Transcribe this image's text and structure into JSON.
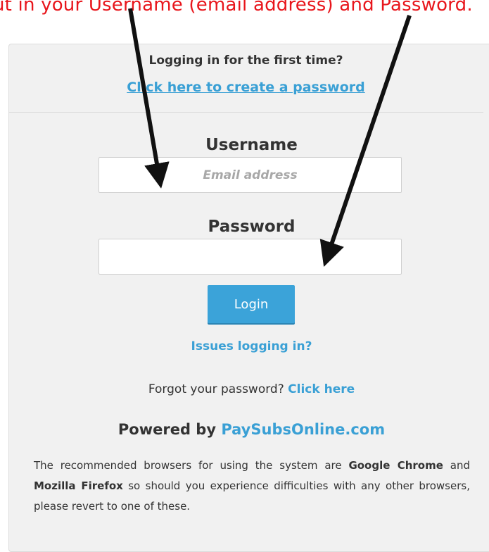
{
  "instruction": "ut in your Username (email address) and Password.",
  "first_time": {
    "question": "Logging in for the first time?",
    "link": "Click here to create a password"
  },
  "username": {
    "label": "Username",
    "placeholder": "Email address",
    "value": ""
  },
  "password": {
    "label": "Password",
    "value": ""
  },
  "login_button": "Login",
  "issues_link": "Issues logging in?",
  "forgot": {
    "text": "Forgot your password?",
    "link": "Click here"
  },
  "powered": {
    "prefix": "Powered by",
    "link": "PaySubsOnline.com"
  },
  "note": {
    "part1": "The recommended browsers for using the system are",
    "browser1": "Google Chrome",
    "and": "and",
    "browser2": "Mozilla Firefox",
    "part2": "so should you experience difficulties with any other browsers, please revert to one of these."
  },
  "colors": {
    "instruction": "#e8161c",
    "link": "#3aa0d5",
    "button": "#3ba3d9",
    "panel": "#f1f1f1"
  }
}
